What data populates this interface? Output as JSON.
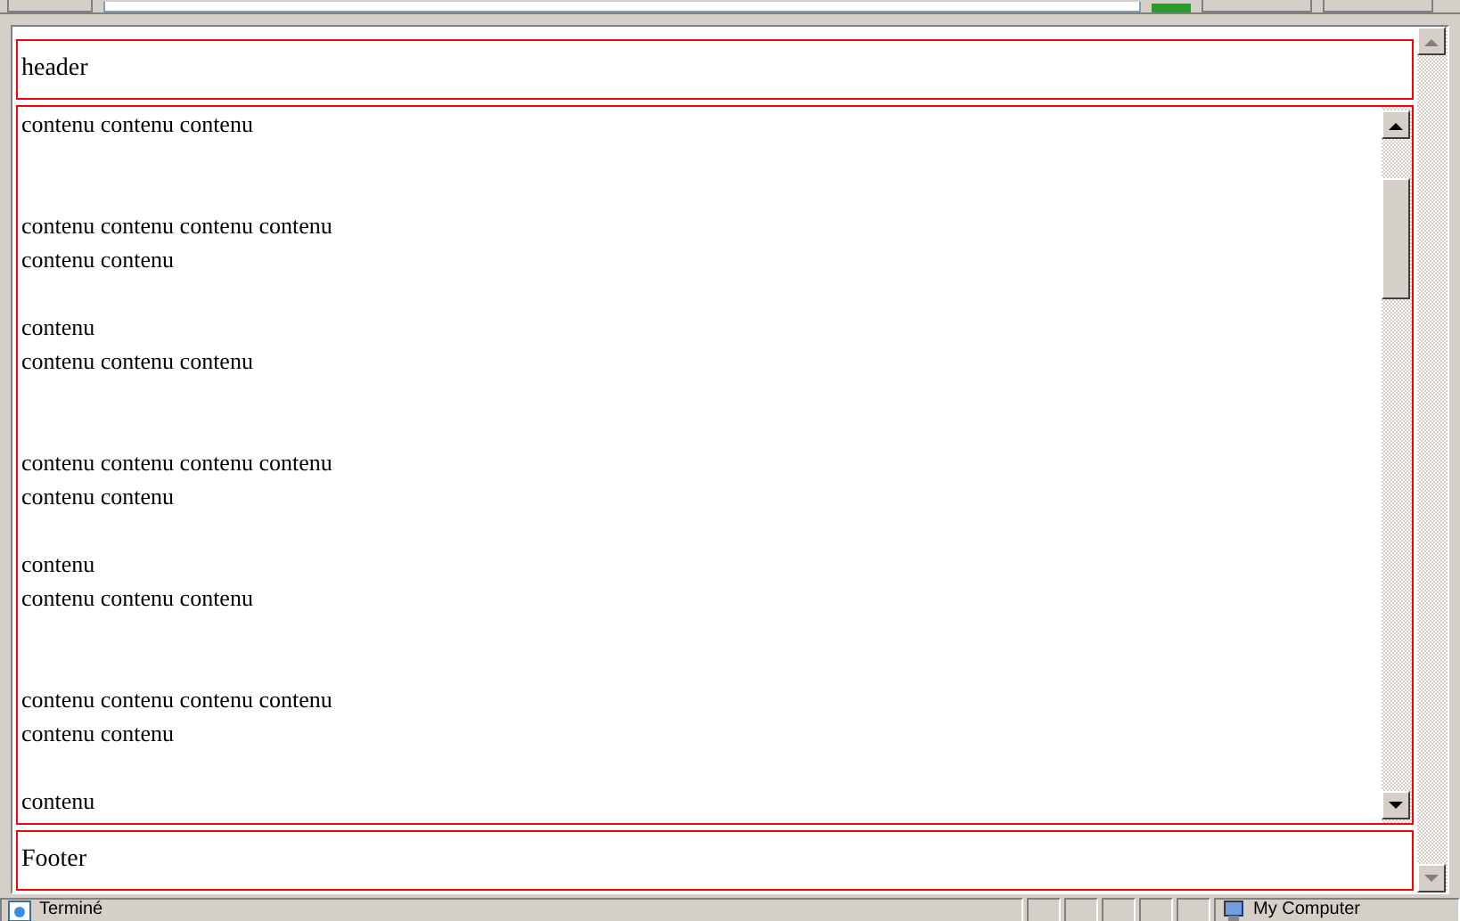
{
  "header": {
    "text": "header"
  },
  "content": {
    "lines": [
      {
        "kind": "line",
        "text": "contenu contenu contenu"
      },
      {
        "kind": "break"
      },
      {
        "kind": "break"
      },
      {
        "kind": "line",
        "text": "contenu contenu contenu contenu"
      },
      {
        "kind": "line",
        "text": "contenu contenu"
      },
      {
        "kind": "break"
      },
      {
        "kind": "line",
        "text": "contenu"
      },
      {
        "kind": "line",
        "text": "contenu contenu contenu"
      },
      {
        "kind": "break"
      },
      {
        "kind": "break"
      },
      {
        "kind": "line",
        "text": "contenu contenu contenu contenu"
      },
      {
        "kind": "line",
        "text": "contenu contenu"
      },
      {
        "kind": "break"
      },
      {
        "kind": "line",
        "text": "contenu"
      },
      {
        "kind": "line",
        "text": "contenu contenu contenu"
      },
      {
        "kind": "break"
      },
      {
        "kind": "break"
      },
      {
        "kind": "line",
        "text": "contenu contenu contenu contenu"
      },
      {
        "kind": "line",
        "text": "contenu contenu"
      },
      {
        "kind": "break"
      },
      {
        "kind": "line",
        "text": "contenu"
      }
    ]
  },
  "footer": {
    "text": "Footer"
  },
  "status_bar": {
    "status": "Terminé",
    "zone": "My Computer"
  }
}
